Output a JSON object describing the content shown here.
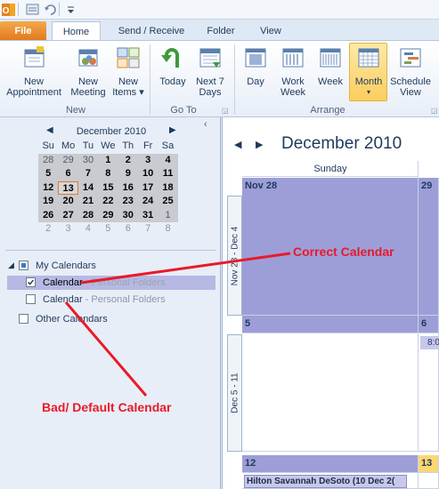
{
  "ribbon_tabs": [
    "File",
    "Home",
    "Send / Receive",
    "Folder",
    "View"
  ],
  "ribbon": {
    "new_appointment": [
      "New",
      "Appointment"
    ],
    "new_meeting": [
      "New",
      "Meeting"
    ],
    "new_items": [
      "New",
      "Items ▾"
    ],
    "today": "Today",
    "next7": [
      "Next 7",
      "Days"
    ],
    "day": "Day",
    "work_week": [
      "Work",
      "Week"
    ],
    "week": "Week",
    "month": [
      "Month",
      "▾"
    ],
    "schedule": [
      "Schedule",
      "View"
    ],
    "groups": {
      "new": "New",
      "goto": "Go To",
      "arrange": "Arrange"
    }
  },
  "mini_calendar": {
    "title": "December 2010",
    "weekdays": [
      "Su",
      "Mo",
      "Tu",
      "We",
      "Th",
      "Fr",
      "Sa"
    ],
    "weeks": [
      [
        "28",
        "29",
        "30",
        "1",
        "2",
        "3",
        "4"
      ],
      [
        "5",
        "6",
        "7",
        "8",
        "9",
        "10",
        "11"
      ],
      [
        "12",
        "13",
        "14",
        "15",
        "16",
        "17",
        "18"
      ],
      [
        "19",
        "20",
        "21",
        "22",
        "23",
        "24",
        "25"
      ],
      [
        "26",
        "27",
        "28",
        "29",
        "30",
        "31",
        "1"
      ],
      [
        "2",
        "3",
        "4",
        "5",
        "6",
        "7",
        "8"
      ]
    ]
  },
  "folders": {
    "my_calendars": "My Calendars",
    "cal1_name": "Calendar",
    "cal1_suffix": " - Personal Folders",
    "cal2_name": "Calendar",
    "cal2_suffix": " - Personal Folders",
    "other_calendars": "Other Calendars"
  },
  "calendar": {
    "title": "December 2010",
    "day_header": "Sunday",
    "week1_range": "Nov 28 - Dec 4",
    "week2_range": "Dec 5 - 11",
    "cell_nov28": "Nov 28",
    "cell_29": "29",
    "cell_5": "5",
    "cell_6": "6",
    "cell_6_time": "8:0",
    "cell_12": "12",
    "cell_13": "13",
    "event_12": "Hilton Savannah DeSoto (10 Dec 2("
  },
  "annotations": {
    "correct": "Correct Calendar",
    "bad": "Bad/ Default Calendar"
  },
  "colors": {
    "annotation": "#e81a2a",
    "month_bg": "#9d9ed8",
    "file_tab": "#e0781c"
  }
}
